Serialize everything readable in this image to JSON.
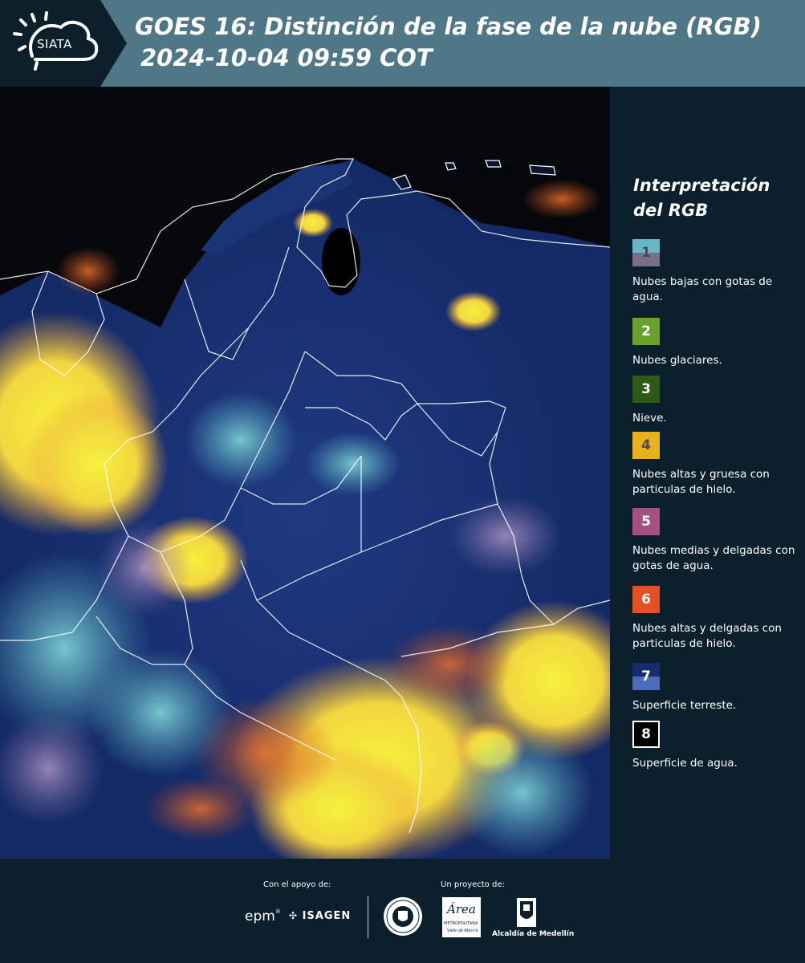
{
  "header": {
    "logo_text": "SIATA",
    "title_line1": "GOES 16: Distinción de la fase de la nube (RGB)",
    "title_line2": "2024-10-04 09:59 COT"
  },
  "legend": {
    "title": "Interpretación del RGB",
    "items": [
      {
        "number": "1",
        "label": "Nubes bajas con gotas de agua.",
        "colors": [
          "#67b8c6",
          "#776f8c"
        ],
        "number_color": "#4c4a58"
      },
      {
        "number": "2",
        "label": "Nubes glaciares.",
        "colors": [
          "#6aa02d"
        ],
        "number_color": "#ffffff"
      },
      {
        "number": "3",
        "label": "Nieve.",
        "colors": [
          "#2d5a17"
        ],
        "number_color": "#ffffff"
      },
      {
        "number": "4",
        "label": "Nubes altas y gruesa con particulas de hielo.",
        "colors": [
          "#e8b21c"
        ],
        "number_color": "#4a4a4a"
      },
      {
        "number": "5",
        "label": "Nubes medias y delgadas con gotas de agua.",
        "colors": [
          "#a5517f"
        ],
        "number_color": "#ffffff"
      },
      {
        "number": "6",
        "label": "Nubes altas y delgadas con particulas de hielo.",
        "colors": [
          "#e45024"
        ],
        "number_color": "#ffffff"
      },
      {
        "number": "7",
        "label": "Superficie terreste.",
        "colors": [
          "#172c6a",
          "#4b6cb9"
        ],
        "number_color": "#ffffff"
      },
      {
        "number": "8",
        "label": "Superficie de agua.",
        "colors": [
          "#000000"
        ],
        "number_color": "#ffffff"
      }
    ]
  },
  "footer": {
    "support_label": "Con el apoyo de:",
    "project_label": "Un proyecto de:",
    "sponsor_epm": "epm",
    "sponsor_isagen": "ISAGEN",
    "metropolitana_name": "Área",
    "metropolitana_sub": "METROPOLITANA",
    "metropolitana_tag": "Valle de Aburrá",
    "alcaldia": "Alcaldía de Medellín"
  }
}
